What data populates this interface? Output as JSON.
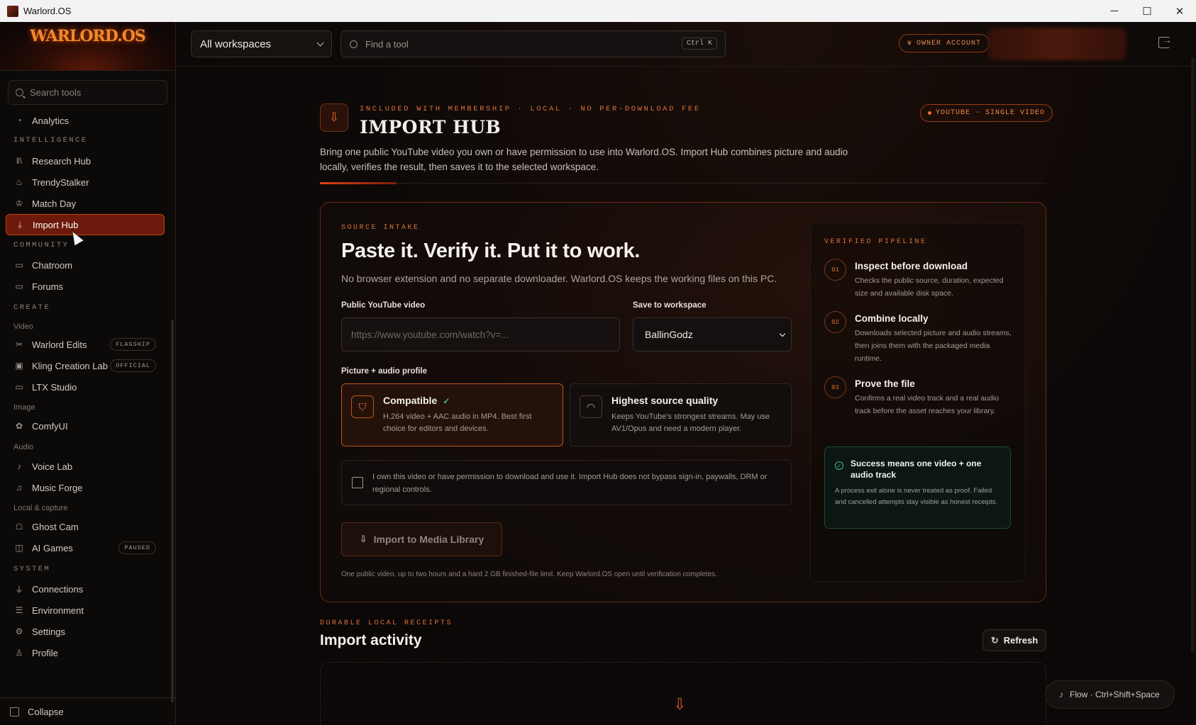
{
  "window": {
    "title": "Warlord.OS",
    "controls": [
      "─",
      "☐",
      "✕"
    ]
  },
  "sidebar": {
    "logo": "WARLORD.OS",
    "search_placeholder": "Search tools",
    "sections": {
      "intelligence": "INTELLIGENCE",
      "community": "COMMUNITY",
      "create": "CREATE",
      "system": "SYSTEM"
    },
    "subsections": {
      "video": "Video",
      "image": "Image",
      "audio": "Audio",
      "local": "Local & capture"
    },
    "items": {
      "analytics": "Analytics",
      "research": "Research Hub",
      "trendy": "TrendyStalker",
      "match": "Match Day",
      "import": "Import Hub",
      "chatroom": "Chatroom",
      "forums": "Forums",
      "warlord_edits": "Warlord Edits",
      "kling": "Kling Creation Lab",
      "ltx": "LTX Studio",
      "comfy": "ComfyUI",
      "voice": "Voice Lab",
      "music": "Music Forge",
      "ghost": "Ghost Cam",
      "ai_games": "AI Games",
      "connections": "Connections",
      "environment": "Environment",
      "settings": "Settings",
      "profile": "Profile"
    },
    "badges": {
      "flagship": "FLAGSHIP",
      "official": "OFFICIAL",
      "paused": "PAUSED"
    },
    "collapse": "Collapse"
  },
  "topbar": {
    "workspace": "All workspaces",
    "search_placeholder": "Find a tool",
    "shortcut": "Ctrl K",
    "owner": "OWNER ACCOUNT"
  },
  "header": {
    "eyebrow": "INCLUDED WITH MEMBERSHIP · LOCAL · NO PER-DOWNLOAD FEE",
    "title": "IMPORT HUB",
    "badge": "YOUTUBE · SINGLE VIDEO",
    "description": "Bring one public YouTube video you own or have permission to use into Warlord.OS. Import Hub combines picture and audio locally, verifies the result, then saves it to the selected workspace."
  },
  "intake": {
    "eyebrow": "SOURCE INTAKE",
    "title": "Paste it. Verify it. Put it to work.",
    "subtitle": "No browser extension and no separate downloader. Warlord.OS keeps the working files on this PC.",
    "url_label": "Public YouTube video",
    "url_placeholder": "https://www.youtube.com/watch?v=...",
    "workspace_label": "Save to workspace",
    "workspace_value": "BallinGodz",
    "profile_label": "Picture + audio profile",
    "options": [
      {
        "title": "Compatible",
        "desc": "H.264 video + AAC audio in MP4. Best first choice for editors and devices.",
        "selected": true
      },
      {
        "title": "Highest source quality",
        "desc": "Keeps YouTube's strongest streams. May use AV1/Opus and need a modern player.",
        "selected": false
      }
    ],
    "consent": "I own this video or have permission to download and use it. Import Hub does not bypass sign-in, paywalls, DRM or regional controls.",
    "button": "Import to Media Library",
    "footnote": "One public video, up to two hours and a hard 2 GB finished-file limit. Keep Warlord.OS open until verification completes."
  },
  "pipeline": {
    "eyebrow": "VERIFIED PIPELINE",
    "steps": [
      {
        "n": "01",
        "title": "Inspect before download",
        "desc": "Checks the public source, duration, expected size and available disk space."
      },
      {
        "n": "02",
        "title": "Combine locally",
        "desc": "Downloads selected picture and audio streams, then joins them with the packaged media runtime."
      },
      {
        "n": "03",
        "title": "Prove the file",
        "desc": "Confirms a real video track and a real audio track before the asset reaches your library."
      }
    ],
    "success_title": "Success means one video + one audio track",
    "success_desc": "A process exit alone is never treated as proof. Failed and cancelled attempts stay visible as honest receipts."
  },
  "activity": {
    "eyebrow": "DURABLE LOCAL RECEIPTS",
    "title": "Import activity",
    "refresh": "Refresh"
  },
  "flow": "Flow · Ctrl+Shift+Space"
}
